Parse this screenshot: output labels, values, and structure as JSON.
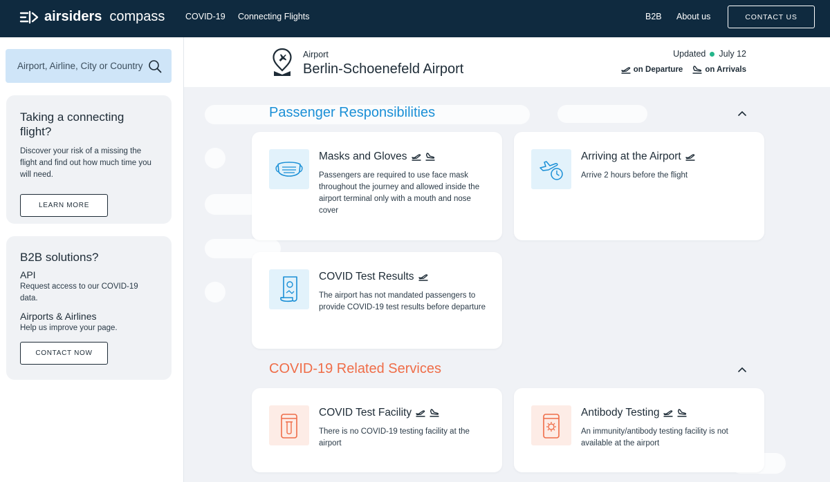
{
  "brand": {
    "name_bold": "airsiders",
    "name_light": "compass"
  },
  "nav": {
    "covid": "COVID-19",
    "connecting": "Connecting Flights",
    "b2b": "B2B",
    "about": "About us",
    "contact": "CONTACT US"
  },
  "search": {
    "placeholder": "Airport, Airline, City or Country"
  },
  "connecting_card": {
    "title": "Taking a connecting flight?",
    "text": "Discover your risk of a missing the flight and find out how much time you will need.",
    "button": "LEARN MORE"
  },
  "b2b_card": {
    "title": "B2B solutions?",
    "api_title": "API",
    "api_text": "Request access to our COVID-19 data.",
    "airlines_title": "Airports & Airlines",
    "airlines_text": "Help us improve your page.",
    "button": "CONTACT NOW"
  },
  "airport": {
    "label": "Airport",
    "name": "Berlin-Schoenefeld Airport"
  },
  "updated": {
    "label": "Updated",
    "date": "July 12"
  },
  "legend": {
    "departure": "on Departure",
    "arrivals": "on Arrivals"
  },
  "sections": {
    "responsibilities": "Passenger Responsibilities",
    "services": "COVID-19 Related Services"
  },
  "cards": {
    "masks": {
      "title": "Masks and Gloves",
      "desc": "Passengers are required to use face mask throughout the journey and allowed inside the airport terminal only with a mouth and nose cover"
    },
    "arriving": {
      "title": "Arriving at the Airport",
      "desc": "Arrive 2 hours before the flight"
    },
    "test_results": {
      "title": "COVID Test Results",
      "desc": "The airport has not mandated passengers to provide COVID-19 test results before departure"
    },
    "test_facility": {
      "title": "COVID Test Facility",
      "desc": "There is no COVID-19 testing facility at the airport"
    },
    "antibody": {
      "title": "Antibody Testing",
      "desc": "An immunity/antibody testing facility is not available at the airport"
    }
  },
  "colors": {
    "nav_bg": "#0f2a3f",
    "accent_blue": "#1a8fd6",
    "accent_orange": "#ef6d48",
    "status_green": "#25b58a"
  }
}
